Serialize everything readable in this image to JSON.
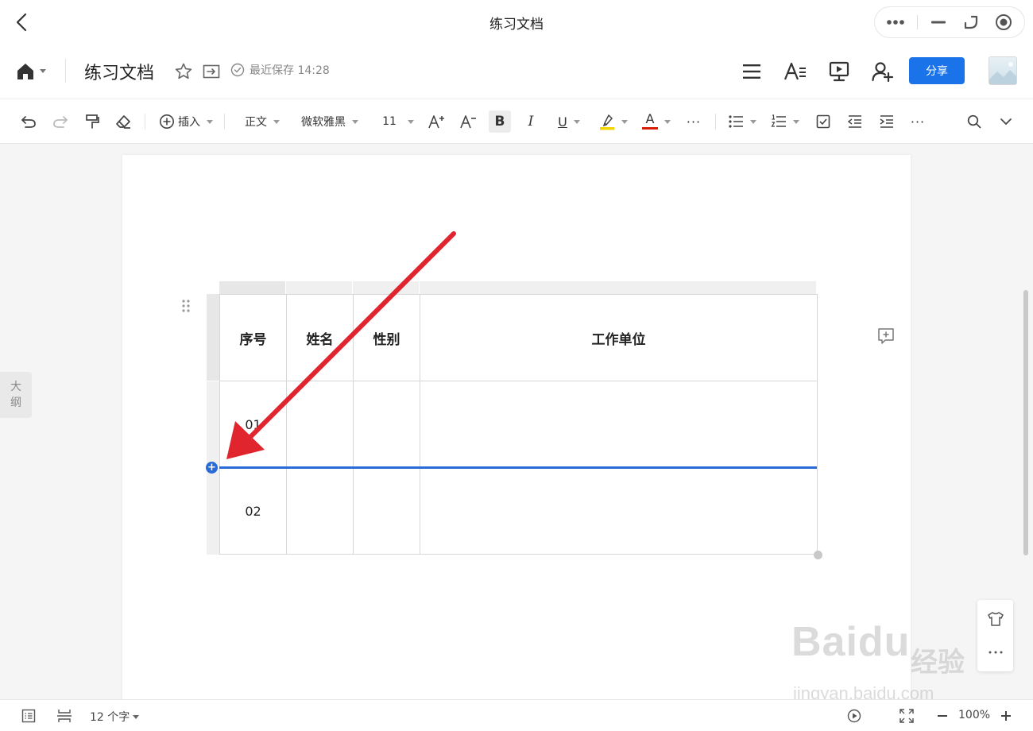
{
  "window": {
    "title": "练习文档"
  },
  "doc": {
    "title": "练习文档",
    "save_status": "最近保存 14:28",
    "share_label": "分享"
  },
  "toolbar": {
    "insert_label": "插入",
    "style_label": "正文",
    "font_label": "微软雅黑",
    "size_label": "11",
    "bold": "B",
    "italic": "I",
    "underline": "U",
    "font_color": "A",
    "more": "···"
  },
  "sidebar": {
    "outline_label_1": "大",
    "outline_label_2": "纲"
  },
  "table": {
    "headers": [
      "序号",
      "姓名",
      "性别",
      "工作单位"
    ],
    "rows": [
      [
        "01",
        "",
        "",
        ""
      ],
      [
        "02",
        "",
        "",
        ""
      ]
    ]
  },
  "insert_row_symbol": "+",
  "statusbar": {
    "word_count": "12 个字",
    "zoom": "100%"
  },
  "watermark": {
    "brand": "Bai",
    "brand2": "du",
    "cn": "经验",
    "url": "jingyan.baidu.com"
  },
  "colors": {
    "accent": "#1a73e8",
    "insert_line": "#2a6ad6",
    "arrow": "#e0252e",
    "highlight": "#f2d600",
    "font_red": "#d81e06"
  },
  "icons": [
    "back-icon",
    "more-dots-icon",
    "minimize-icon",
    "restore-icon",
    "record-icon",
    "home-icon",
    "star-icon",
    "move-icon",
    "check-circle-icon",
    "menu-icon",
    "text-style-icon",
    "present-icon",
    "add-user-icon",
    "undo-icon",
    "redo-icon",
    "format-painter-icon",
    "eraser-icon",
    "search-icon",
    "chevron-down-icon",
    "comment-add-icon",
    "shirt-icon"
  ]
}
